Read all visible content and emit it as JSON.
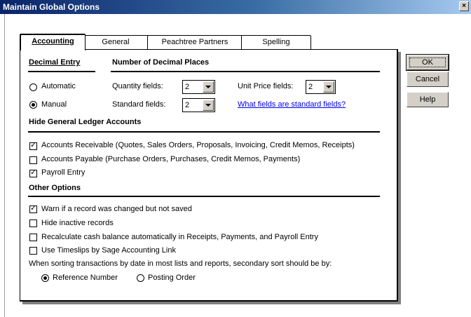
{
  "window": {
    "title": "Maintain Global Options",
    "close_glyph": "×"
  },
  "tabs": [
    {
      "label": "Accounting",
      "active": true
    },
    {
      "label": "General",
      "active": false
    },
    {
      "label": "Peachtree Partners",
      "active": false
    },
    {
      "label": "Spelling",
      "active": false
    }
  ],
  "decimal_entry": {
    "header": "Decimal Entry",
    "automatic_label": "Automatic",
    "manual_label": "Manual",
    "selected": "Manual"
  },
  "decimal_places": {
    "header": "Number of Decimal Places",
    "quantity_label": "Quantity fields:",
    "quantity_value": "2",
    "unit_price_label": "Unit Price fields:",
    "unit_price_value": "2",
    "standard_label": "Standard fields:",
    "standard_value": "2",
    "standard_link": "What fields are standard fields?"
  },
  "hide_gl": {
    "header": "Hide General Ledger Accounts",
    "items": [
      {
        "label": "Accounts Receivable (Quotes, Sales Orders, Proposals, Invoicing, Credit Memos, Receipts)",
        "checked": true
      },
      {
        "label": "Accounts Payable (Purchase Orders, Purchases, Credit Memos, Payments)",
        "checked": false
      },
      {
        "label": "Payroll Entry",
        "checked": true
      }
    ]
  },
  "other_options": {
    "header": "Other Options",
    "items": [
      {
        "label": "Warn if a record was changed but not saved",
        "checked": true
      },
      {
        "label": "Hide inactive records",
        "checked": false
      },
      {
        "label": "Recalculate cash balance automatically in Receipts, Payments, and Payroll Entry",
        "checked": false
      },
      {
        "label": "Use Timeslips by Sage Accounting Link",
        "checked": false
      }
    ],
    "sort_text": "When sorting transactions by date in most lists and reports, secondary sort should be by:",
    "sort_reference_label": "Reference Number",
    "sort_posting_label": "Posting Order",
    "sort_selected": "Reference Number"
  },
  "buttons": {
    "ok": "OK",
    "cancel": "Cancel",
    "help": "Help"
  }
}
